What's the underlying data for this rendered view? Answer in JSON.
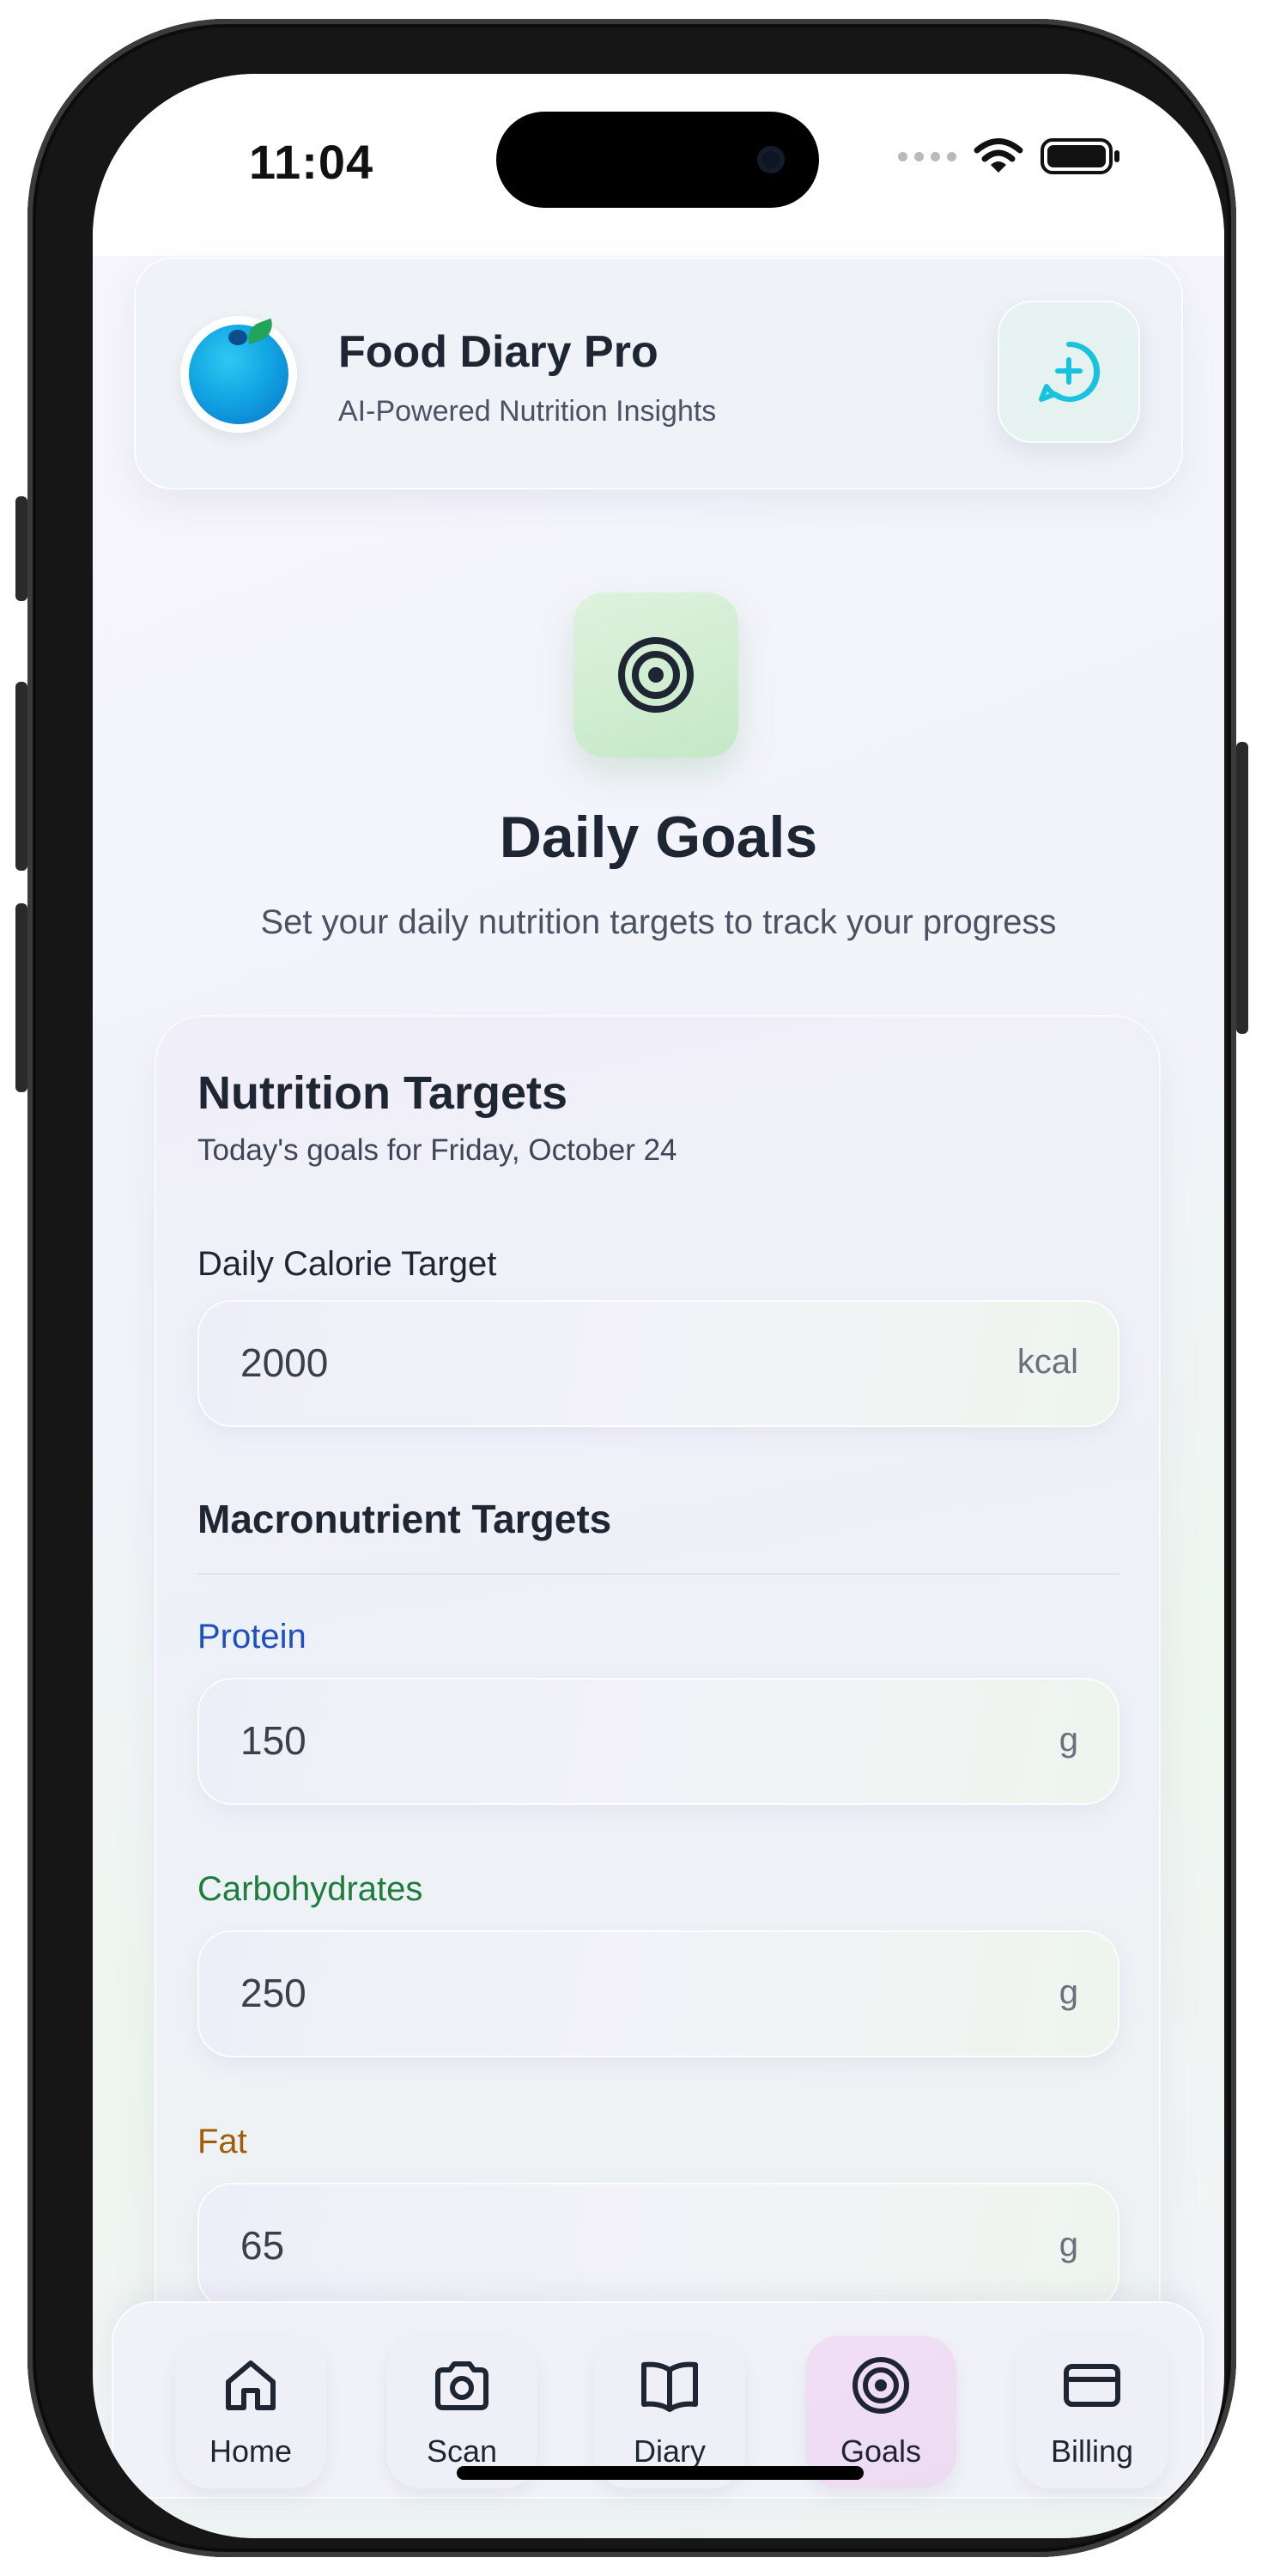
{
  "status_bar": {
    "time": "11:04",
    "icons": [
      "signal-dots-icon",
      "wifi-icon",
      "battery-icon"
    ]
  },
  "header": {
    "app_name": "Food Diary Pro",
    "tagline": "AI-Powered Nutrition Insights",
    "logo_icon": "blueberry-logo-icon",
    "chat_icon": "chat-plus-icon",
    "accent_color": "#17c3dd"
  },
  "hero": {
    "icon": "target-icon",
    "title": "Daily Goals",
    "subtitle": "Set your daily nutrition targets to track your progress"
  },
  "targets": {
    "title": "Nutrition Targets",
    "date_line": "Today's goals for Friday, October 24",
    "calories": {
      "label": "Daily Calorie Target",
      "value": "2000",
      "unit": "kcal"
    },
    "macros_title": "Macronutrient Targets",
    "protein": {
      "label": "Protein",
      "value": "150",
      "unit": "g",
      "color": "#1d4fbf"
    },
    "carbs": {
      "label": "Carbohydrates",
      "value": "250",
      "unit": "g",
      "color": "#1d7d3d"
    },
    "fat": {
      "label": "Fat",
      "value": "65",
      "unit": "g",
      "color": "#a15c05"
    }
  },
  "nav": {
    "items": [
      {
        "label": "Home",
        "icon": "home-icon",
        "active": false
      },
      {
        "label": "Scan",
        "icon": "camera-icon",
        "active": false
      },
      {
        "label": "Diary",
        "icon": "book-icon",
        "active": false
      },
      {
        "label": "Goals",
        "icon": "target-icon",
        "active": true
      },
      {
        "label": "Billing",
        "icon": "credit-card-icon",
        "active": false
      }
    ]
  }
}
